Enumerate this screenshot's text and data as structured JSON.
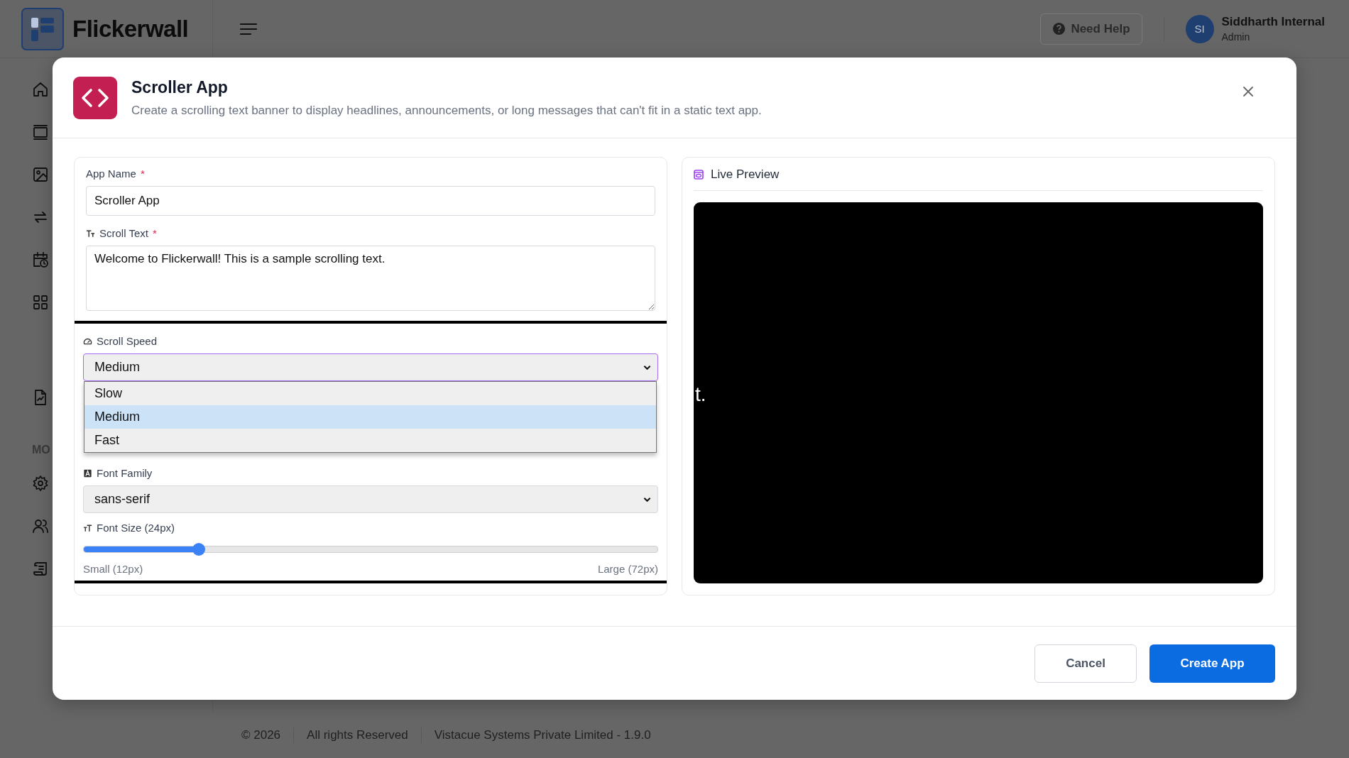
{
  "topbar": {
    "brand": "Flickerwall",
    "help_button": "Need Help",
    "user": {
      "initials": "SI",
      "name": "Siddharth Internal",
      "role": "Admin"
    }
  },
  "sidebar": {
    "items": [
      {
        "kind": "home"
      },
      {
        "kind": "monitor"
      },
      {
        "kind": "image"
      },
      {
        "kind": "repeat"
      },
      {
        "kind": "calendar"
      },
      {
        "kind": "grid"
      },
      {
        "kind": "report"
      }
    ],
    "section_label": "MO",
    "section_items": [
      {
        "kind": "settings"
      },
      {
        "kind": "users"
      },
      {
        "kind": "scroll"
      }
    ]
  },
  "modal": {
    "title": "Scroller App",
    "description": "Create a scrolling text banner to display headlines, announcements, or long messages that can't fit in a static text app.",
    "groups": [
      {
        "highlighted": false,
        "fields": [
          {
            "kind": "text",
            "label": "App Name",
            "required_mark": "*",
            "value": "Scroller App"
          },
          {
            "kind": "textarea",
            "label": "Scroll Text",
            "required_mark": "*",
            "value": "Welcome to Flickerwall! This is a sample scrolling text."
          }
        ]
      },
      {
        "highlighted": true,
        "fields": [
          {
            "kind": "select",
            "label": "Scroll Speed",
            "value": "Medium",
            "expanded": true,
            "options": [
              {
                "label": "Slow",
                "selected": false
              },
              {
                "label": "Medium",
                "selected": true
              },
              {
                "label": "Fast",
                "selected": false
              }
            ]
          },
          {
            "kind": "select",
            "label": "Font Family",
            "value": "sans-serif",
            "expanded": false
          },
          {
            "kind": "slider",
            "label": "Font Size (24px)",
            "level": 0.2,
            "min_label": "Small (12px)",
            "max_label": "Large (72px)"
          }
        ]
      }
    ],
    "preview": {
      "title": "Live Preview",
      "text": "t."
    },
    "buttons": [
      {
        "label": "Cancel",
        "kind": "secondary"
      },
      {
        "label": "Create App",
        "kind": "primary"
      }
    ]
  },
  "footer": [
    "© 2026",
    "All rights Reserved",
    "Vistacue Systems Private Limited - 1.9.0"
  ]
}
